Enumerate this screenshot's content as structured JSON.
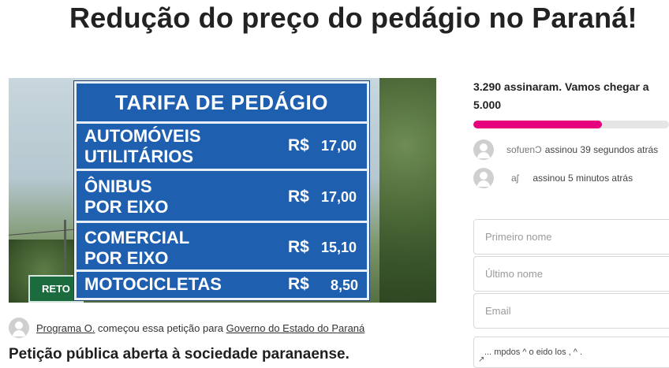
{
  "page": {
    "title": "Redução do preço do pedágio no Paraná!"
  },
  "hero": {
    "side_sign": "RETO",
    "sign_title": "TARIFA DE PEDÁGIO",
    "rows": [
      {
        "line1": "AUTOMÓVEIS",
        "line2": "UTILITÁRIOS",
        "currency": "R$",
        "price": "17,00"
      },
      {
        "line1": "ÔNIBUS",
        "line2": "POR EIXO",
        "currency": "R$",
        "price": "17,00"
      },
      {
        "line1": "COMERCIAL",
        "line2": "POR EIXO",
        "currency": "R$",
        "price": "15,10"
      },
      {
        "line1": "MOTOCICLETAS",
        "line2": "",
        "currency": "R$",
        "price": "8,50"
      }
    ]
  },
  "starter": {
    "author": "Programa O.",
    "text": " começou essa petição para ",
    "target": "Governo do Estado do Paraná"
  },
  "headline": "Petição pública aberta à sociedade paranaense.",
  "goal": {
    "line1": "3.290 assinaram. Vamos chegar a",
    "line2": "5.000",
    "progress_fraction": 0.658,
    "color": "#e6007e"
  },
  "signers": [
    {
      "name": "sofuɐnƆ",
      "action": "assinou 39 segundos atrás"
    },
    {
      "name": "aʃ",
      "action": "assinou 5 minutos atrás"
    }
  ],
  "form": {
    "first_name_placeholder": "Primeiro nome",
    "last_name_placeholder": "Último nome",
    "email_placeholder": "Email",
    "country_text": "... mpdos  ^ o  eido los ,  ^ ."
  }
}
